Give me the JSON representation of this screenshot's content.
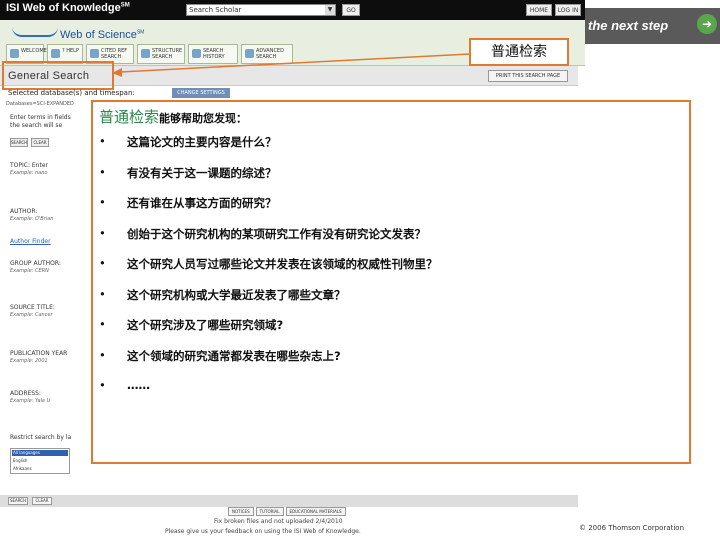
{
  "isi": {
    "logo": "ISI Web of Knowledge",
    "logo_sup": "SM",
    "search_select": "Search Scholar",
    "go": "GO",
    "home": "HOME",
    "login": "LOG IN",
    "tagline": "the next step"
  },
  "wos": {
    "title": "Web of Science",
    "title_sup": "SM",
    "tabs": [
      "WELCOME",
      "? HELP",
      "CITED REF SEARCH",
      "STRUCTURE SEARCH",
      "SEARCH HISTORY",
      "ADVANCED SEARCH"
    ]
  },
  "general_search": {
    "title": "General Search",
    "print_button": "PRINT THIS SEARCH PAGE",
    "selected": "Selected database(s) and timespan:",
    "change_button": "CHANGE SETTINGS",
    "databases_line": "Databases=SCI-EXPANDED"
  },
  "form": {
    "intro1": "Enter terms in fields",
    "intro2": "the search will se",
    "search_btn": "SEARCH",
    "clear_btn": "CLEAR",
    "topic_label": "TOPIC: Enter",
    "topic_example": "Example: nano",
    "author_label": "AUTHOR:",
    "author_example": "Example: O'Brian",
    "author_finder": "Author Finder",
    "group_author_label": "GROUP AUTHOR:",
    "group_author_example": "Example: CERN",
    "source_title_label": "SOURCE TITLE:",
    "source_title_example": "Example: Cancer",
    "pub_year_label": "PUBLICATION YEAR",
    "pub_year_example": "Example: 2001",
    "address_label": "ADDRESS:",
    "address_example": "Example: Yale U",
    "restrict_label": "Restrict search by la",
    "restrict_options": [
      "All languages",
      "English",
      "Afrikaans"
    ]
  },
  "bottom": {
    "search_btn": "SEARCH",
    "clear_btn": "CLEAR",
    "links": [
      "NOTICES",
      "TUTORIAL",
      "EDUCATIONAL MATERIALS"
    ],
    "footer1": "Fix broken files and not uploaded 2/4/2010",
    "footer2": "Please give us your feedback on using the ISI Web of Knowledge.",
    "copyright": "© 2006 Thomson Corporation"
  },
  "callout": {
    "label": "普通检索"
  },
  "overlay": {
    "title": "普通检索",
    "title_suffix": "能够帮助您发现：",
    "bullet": "•",
    "items": [
      "这篇论文的主要内容是什么？",
      "有没有关于这一课题的综述？",
      "还有谁在从事这方面的研究？",
      "创始于这个研究机构的某项研究工作有没有研究论文发表？",
      "这个研究人员写过哪些论文并发表在该领域的权威性刊物里？",
      "这个研究机构或大学最近发表了哪些文章？",
      "这个研究涉及了哪些研究领域?",
      "这个领域的研究通常都发表在哪些杂志上?",
      "……"
    ]
  },
  "colors": {
    "accent_orange": "#e07a30",
    "title_green": "#2a8a4a",
    "isi_black": "#0d0d0d",
    "wos_blue": "#1f4f8f"
  }
}
